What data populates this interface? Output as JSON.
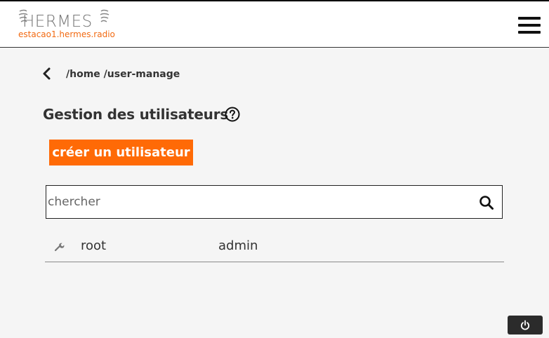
{
  "header": {
    "brand": "HERMES",
    "hostname": "estacao1.hermes.radio",
    "menu_icon": "hamburger-menu-icon"
  },
  "nav": {
    "back_icon": "chevron-left-icon",
    "breadcrumb": "/home /user-manage"
  },
  "main": {
    "title": "Gestion des utilisateurs",
    "help_icon": "question-circle-icon",
    "create_button": "créer un utilisateur",
    "search": {
      "placeholder": "chercher",
      "value": "",
      "icon": "search-icon"
    },
    "users": [
      {
        "icon": "wrench-icon",
        "name": "root",
        "role": "admin"
      }
    ]
  },
  "footer": {
    "power_icon": "power-icon"
  },
  "colors": {
    "accent": "#ff6a06",
    "hostname": "#f26a12",
    "background": "#f5f5f5",
    "header_bg": "#ffffff",
    "power_button": "#2b2b2b"
  }
}
